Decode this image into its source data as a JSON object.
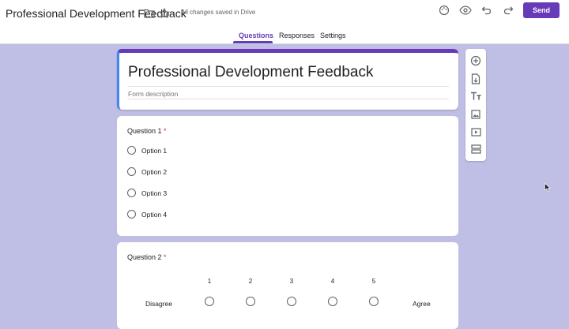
{
  "header": {
    "title": "Professional Development Feedback",
    "saved_status": "All changes saved in Drive",
    "send_label": "Send",
    "icons": [
      "folder-icon",
      "star-icon",
      "palette-icon",
      "eye-icon",
      "undo-icon",
      "redo-icon"
    ]
  },
  "tabs": [
    {
      "label": "Questions",
      "active": true
    },
    {
      "label": "Responses",
      "active": false
    },
    {
      "label": "Settings",
      "active": false
    }
  ],
  "form": {
    "title": "Professional Development Feedback",
    "description_placeholder": "Form description"
  },
  "questions": [
    {
      "title": "Question 1",
      "required_marker": "*",
      "options": [
        "Option 1",
        "Option 2",
        "Option 3",
        "Option 4"
      ]
    },
    {
      "title": "Question 2",
      "required_marker": "*",
      "scale": [
        "1",
        "2",
        "3",
        "4",
        "5"
      ],
      "low_label": "Disagree",
      "high_label": "Agree"
    }
  ],
  "toolbar_icons": [
    "add-question-icon",
    "import-questions-icon",
    "add-title-icon",
    "add-image-icon",
    "add-video-icon",
    "add-section-icon"
  ],
  "colors": {
    "accent": "#673ab7",
    "background": "#bfbfe5",
    "required": "#d93025"
  }
}
